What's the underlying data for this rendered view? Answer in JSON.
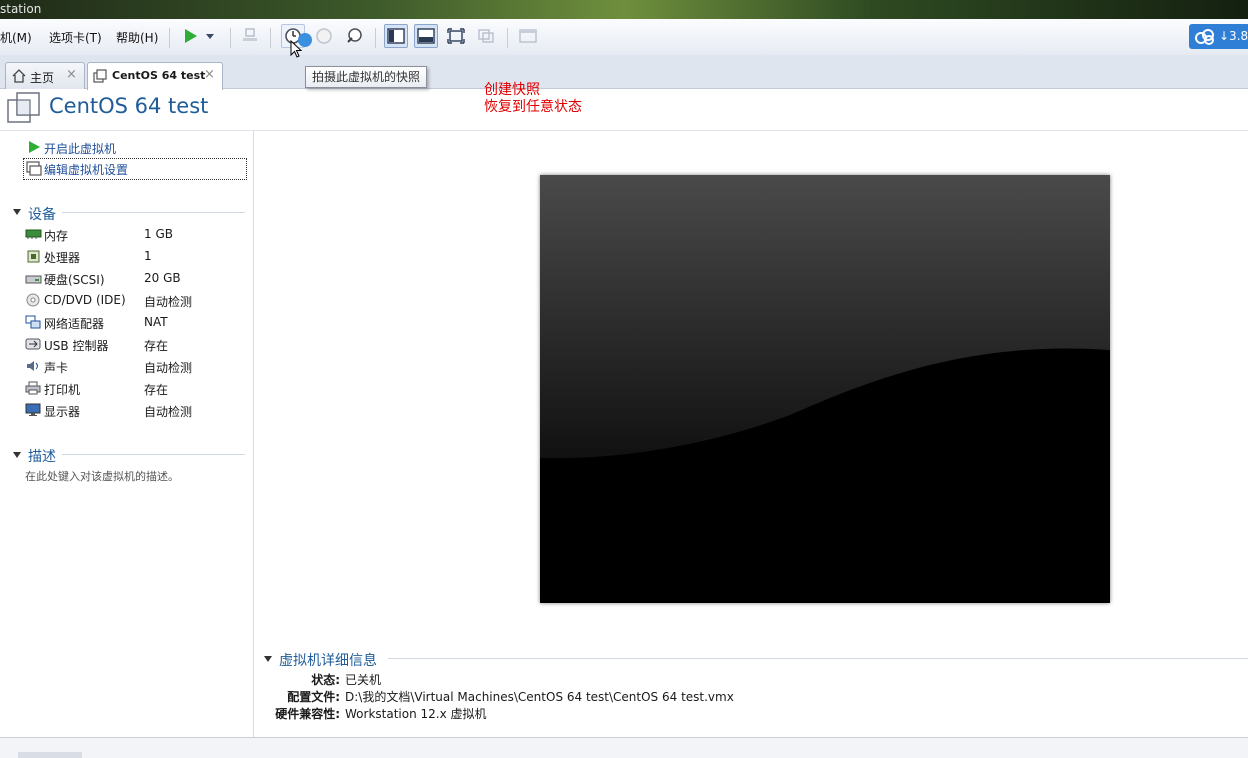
{
  "window": {
    "title": "station"
  },
  "menu": {
    "items": [
      "机(M)",
      "选项卡(T)",
      "帮助(H)"
    ]
  },
  "toolbar": {
    "cloud_text": "↓3.8"
  },
  "tabs": [
    {
      "label": "主页",
      "close": "×"
    },
    {
      "label": "CentOS 64 test",
      "close": "×"
    }
  ],
  "tooltip": {
    "text": "拍摄此虚拟机的快照"
  },
  "vm": {
    "title": "CentOS 64 test"
  },
  "annotation": {
    "line1": "创建快照",
    "line2": "恢复到任意状态"
  },
  "actions": {
    "power_on": "开启此虚拟机",
    "edit_settings": "编辑虚拟机设置"
  },
  "devices": {
    "heading": "设备",
    "items": [
      {
        "name": "内存",
        "value": "1 GB",
        "icon": "memory-icon"
      },
      {
        "name": "处理器",
        "value": "1",
        "icon": "cpu-icon"
      },
      {
        "name": "硬盘(SCSI)",
        "value": "20 GB",
        "icon": "harddisk-icon"
      },
      {
        "name": "CD/DVD (IDE)",
        "value": "自动检测",
        "icon": "cd-icon"
      },
      {
        "name": "网络适配器",
        "value": "NAT",
        "icon": "network-icon"
      },
      {
        "name": "USB 控制器",
        "value": "存在",
        "icon": "usb-icon"
      },
      {
        "name": "声卡",
        "value": "自动检测",
        "icon": "sound-icon"
      },
      {
        "name": "打印机",
        "value": "存在",
        "icon": "printer-icon"
      },
      {
        "name": "显示器",
        "value": "自动检测",
        "icon": "display-icon"
      }
    ]
  },
  "description": {
    "heading": "描述",
    "placeholder": "在此处键入对该虚拟机的描述。"
  },
  "details": {
    "heading": "虚拟机详细信息",
    "rows": [
      {
        "label": "状态:",
        "value": "已关机"
      },
      {
        "label": "配置文件:",
        "value": "D:\\我的文档\\Virtual Machines\\CentOS 64 test\\CentOS 64 test.vmx"
      },
      {
        "label": "硬件兼容性:",
        "value": "Workstation 12.x 虚拟机"
      }
    ]
  },
  "colors": {
    "accent": "#1f5c99",
    "annotation": "#e00000",
    "play": "#2fae35"
  }
}
